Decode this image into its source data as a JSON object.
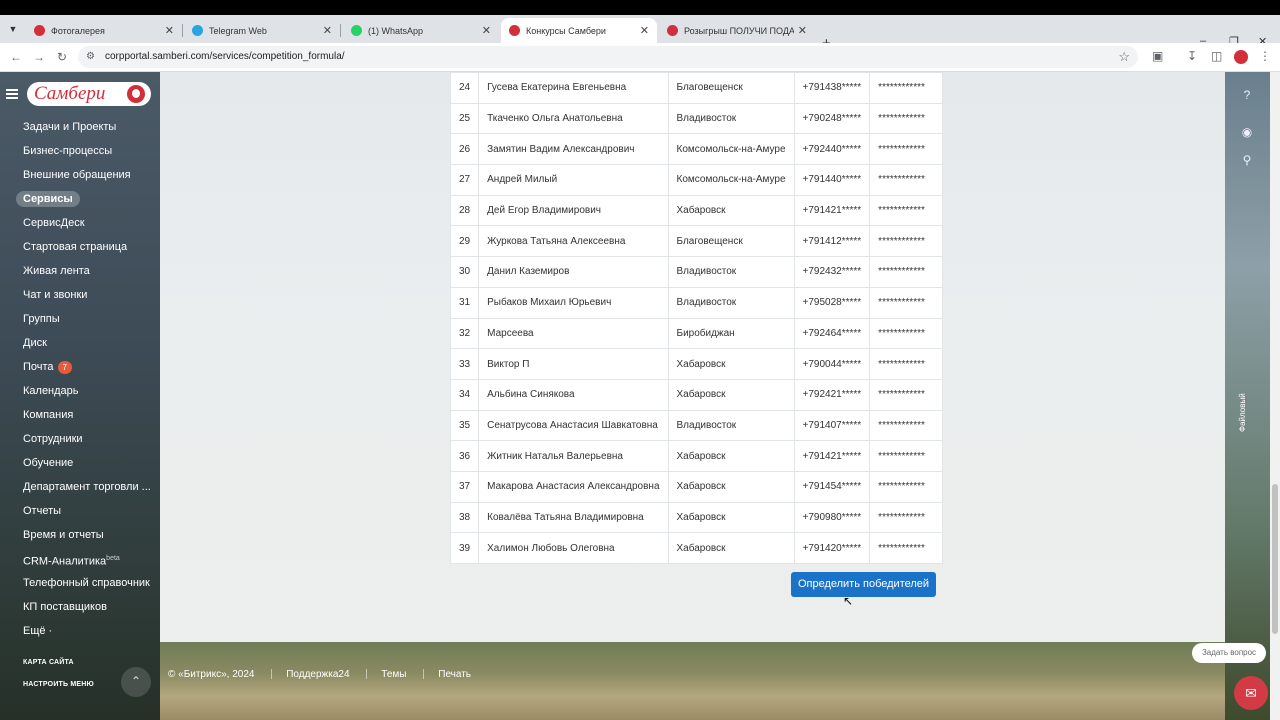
{
  "browser": {
    "tabs": [
      {
        "title": "Фотогалерея",
        "fav_color": "#d32f3a",
        "active": false
      },
      {
        "title": "Telegram Web",
        "fav_color": "#2aa3df",
        "active": false
      },
      {
        "title": "(1) WhatsApp",
        "fav_color": "#25d366",
        "active": false
      },
      {
        "title": "Конкурсы Самбери",
        "fav_color": "#d32f3a",
        "active": true
      },
      {
        "title": "Розыгрыш ПОЛУЧИ ПОДАРО...",
        "fav_color": "#d32f3a",
        "active": false
      }
    ],
    "url": "corpportal.samberi.com/services/competition_formula/"
  },
  "sidebar": {
    "logo_text": "Самбери",
    "items": [
      {
        "label": "Задачи и Проекты"
      },
      {
        "label": "Бизнес-процессы"
      },
      {
        "label": "Внешние обращения"
      },
      {
        "label": "Сервисы",
        "active": true
      },
      {
        "label": "СервисДеск"
      },
      {
        "label": "Стартовая страница"
      },
      {
        "label": "Живая лента"
      },
      {
        "label": "Чат и звонки"
      },
      {
        "label": "Группы"
      },
      {
        "label": "Диск"
      },
      {
        "label": "Почта",
        "counter": "7"
      },
      {
        "label": "Календарь"
      },
      {
        "label": "Компания"
      },
      {
        "label": "Сотрудники"
      },
      {
        "label": "Обучение"
      },
      {
        "label": "Департамент торговли ..."
      },
      {
        "label": "Отчеты"
      },
      {
        "label": "Время и отчеты"
      },
      {
        "label": "CRM-Аналитика",
        "sup": "beta"
      },
      {
        "label": "Телефонный справочник"
      },
      {
        "label": "КП поставщиков"
      },
      {
        "label": "Ещё ·"
      }
    ],
    "sitemap": "КАРТА САЙТА",
    "configure": "НАСТРОИТЬ МЕНЮ"
  },
  "table": {
    "rows": [
      [
        "24",
        "Гусева Екатерина Евгеньевна",
        "Благовещенск",
        "+791438*****",
        "************"
      ],
      [
        "25",
        "Ткаченко Ольга Анатольевна",
        "Владивосток",
        "+790248*****",
        "************"
      ],
      [
        "26",
        "Замятин Вадим Александрович",
        "Комсомольск-на-Амуре",
        "+792440*****",
        "************"
      ],
      [
        "27",
        "Андрей Милый",
        "Комсомольск-на-Амуре",
        "+791440*****",
        "************"
      ],
      [
        "28",
        "Дей Егор Владимирович",
        "Хабаровск",
        "+791421*****",
        "************"
      ],
      [
        "29",
        "Журкова Татьяна Алексеевна",
        "Благовещенск",
        "+791412*****",
        "************"
      ],
      [
        "30",
        "Данил Каземиров",
        "Владивосток",
        "+792432*****",
        "************"
      ],
      [
        "31",
        "Рыбаков Михаил Юрьевич",
        "Владивосток",
        "+795028*****",
        "************"
      ],
      [
        "32",
        "Марсеева",
        "Биробиджан",
        "+792464*****",
        "************"
      ],
      [
        "33",
        "Виктор П",
        "Хабаровск",
        "+790044*****",
        "************"
      ],
      [
        "34",
        "Альбина Синякова",
        "Хабаровск",
        "+792421*****",
        "************"
      ],
      [
        "35",
        "Сенатрусова Анастасия Шавкатовна",
        "Владивосток",
        "+791407*****",
        "************"
      ],
      [
        "36",
        "Житник Наталья Валерьевна",
        "Хабаровск",
        "+791421*****",
        "************"
      ],
      [
        "37",
        "Макарова Анастасия Александровна",
        "Хабаровск",
        "+791454*****",
        "************"
      ],
      [
        "38",
        "Ковалёва Татьяна Владимировна",
        "Хабаровск",
        "+790980*****",
        "************"
      ],
      [
        "39",
        "Халимон Любовь Олеговна",
        "Хабаровск",
        "+791420*****",
        "************"
      ]
    ]
  },
  "main": {
    "winners_button": "Определить победителей"
  },
  "right_panel": {
    "vertical_label": "Файловый"
  },
  "footer": {
    "copyright": "© «Битрикс», 2024",
    "support": "Поддержка24",
    "themes": "Темы",
    "print": "Печать",
    "ask": "Задать вопрос"
  }
}
